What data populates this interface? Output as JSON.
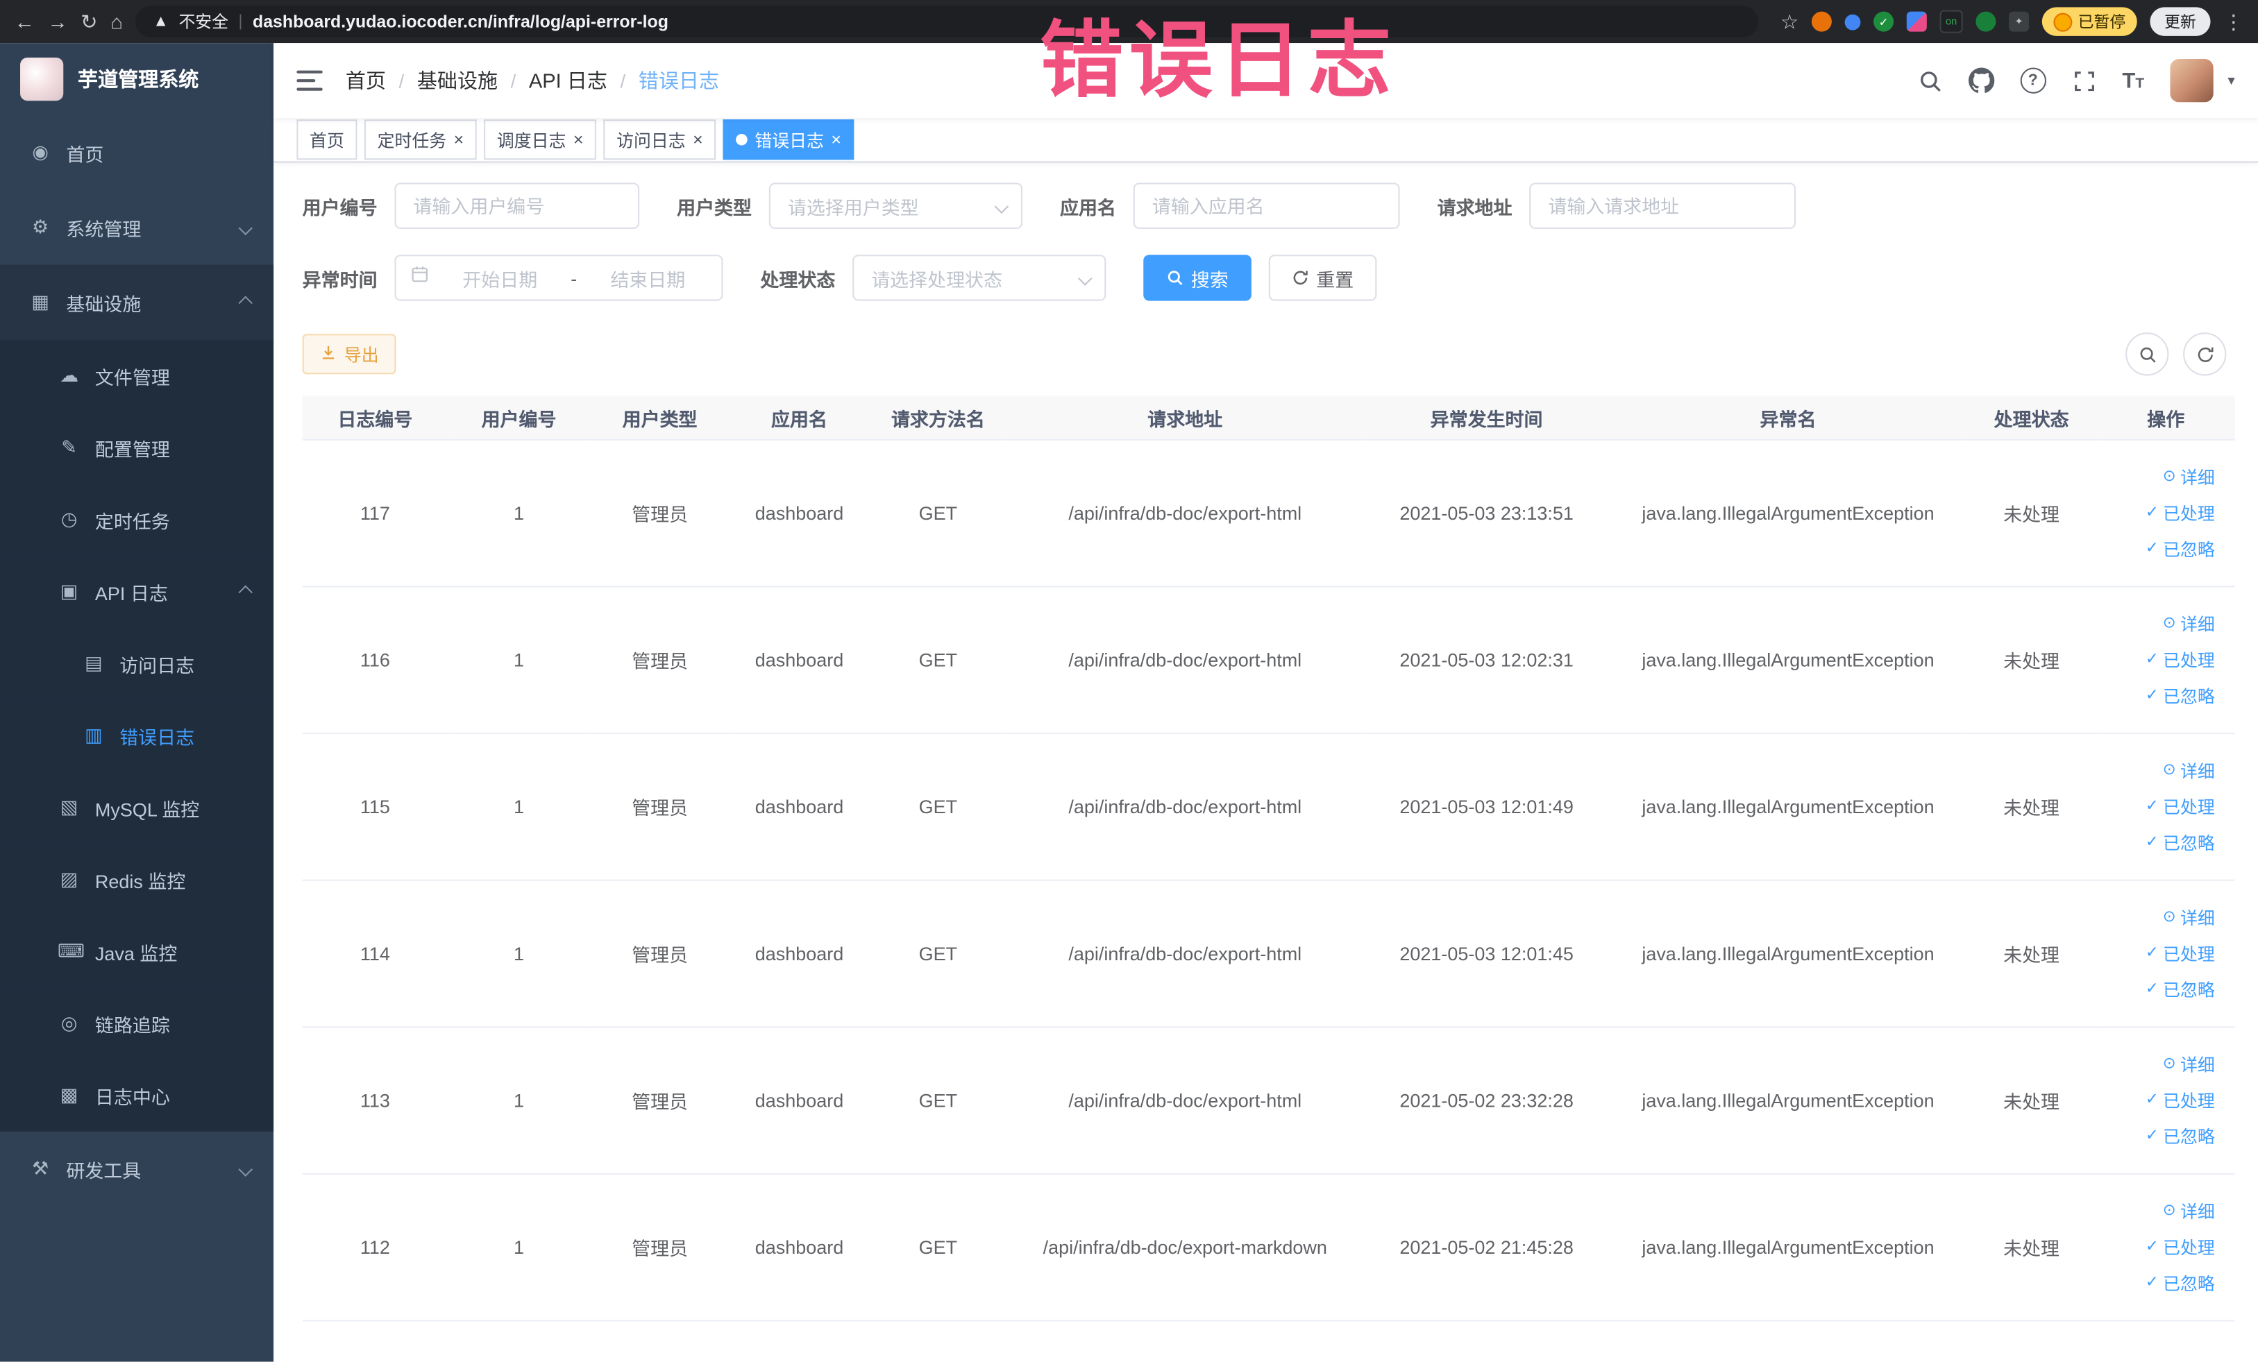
{
  "browser": {
    "security_label": "不安全",
    "url": "dashboard.yudao.iocoder.cn/infra/log/api-error-log",
    "paused_badge": "已暂停",
    "update_button": "更新",
    "extension_badge_on": "on"
  },
  "overlay": {
    "title": "错误日志",
    "color": "#f0517f"
  },
  "sidebar": {
    "app_title": "芋道管理系统",
    "items": {
      "home": "首页",
      "system": "系统管理",
      "infra": "基础设施",
      "file": "文件管理",
      "config": "配置管理",
      "job": "定时任务",
      "api_log": "API 日志",
      "access_log": "访问日志",
      "error_log": "错误日志",
      "mysql": "MySQL 监控",
      "redis": "Redis 监控",
      "java": "Java 监控",
      "trace": "链路追踪",
      "log_center": "日志中心",
      "dev_tools": "研发工具"
    }
  },
  "breadcrumb": {
    "separator": "/",
    "items": [
      "首页",
      "基础设施",
      "API 日志",
      "错误日志"
    ]
  },
  "tabs": [
    {
      "label": "首页"
    },
    {
      "label": "定时任务"
    },
    {
      "label": "调度日志"
    },
    {
      "label": "访问日志"
    },
    {
      "label": "错误日志"
    }
  ],
  "filters": {
    "user_id": {
      "label": "用户编号",
      "placeholder": "请输入用户编号"
    },
    "user_type": {
      "label": "用户类型",
      "placeholder": "请选择用户类型"
    },
    "app_name": {
      "label": "应用名",
      "placeholder": "请输入应用名"
    },
    "request_url": {
      "label": "请求地址",
      "placeholder": "请输入请求地址"
    },
    "exception_time": {
      "label": "异常时间",
      "start_placeholder": "开始日期",
      "separator": "-",
      "end_placeholder": "结束日期"
    },
    "process_status": {
      "label": "处理状态",
      "placeholder": "请选择处理状态"
    },
    "search_button": "搜索",
    "reset_button": "重置"
  },
  "toolbar": {
    "export_button": "导出"
  },
  "table": {
    "columns": [
      "日志编号",
      "用户编号",
      "用户类型",
      "应用名",
      "请求方法名",
      "请求地址",
      "异常发生时间",
      "异常名",
      "处理状态",
      "操作"
    ],
    "row_actions": [
      "详细",
      "已处理",
      "已忽略"
    ],
    "rows": [
      [
        "117",
        "1",
        "管理员",
        "dashboard",
        "GET",
        "/api/infra/db-doc/export-html",
        "2021-05-03 23:13:51",
        "java.lang.IllegalArgumentException",
        "未处理"
      ],
      [
        "116",
        "1",
        "管理员",
        "dashboard",
        "GET",
        "/api/infra/db-doc/export-html",
        "2021-05-03 12:02:31",
        "java.lang.IllegalArgumentException",
        "未处理"
      ],
      [
        "115",
        "1",
        "管理员",
        "dashboard",
        "GET",
        "/api/infra/db-doc/export-html",
        "2021-05-03 12:01:49",
        "java.lang.IllegalArgumentException",
        "未处理"
      ],
      [
        "114",
        "1",
        "管理员",
        "dashboard",
        "GET",
        "/api/infra/db-doc/export-html",
        "2021-05-03 12:01:45",
        "java.lang.IllegalArgumentException",
        "未处理"
      ],
      [
        "113",
        "1",
        "管理员",
        "dashboard",
        "GET",
        "/api/infra/db-doc/export-html",
        "2021-05-02 23:32:28",
        "java.lang.IllegalArgumentException",
        "未处理"
      ],
      [
        "112",
        "1",
        "管理员",
        "dashboard",
        "GET",
        "/api/infra/db-doc/export-markdown",
        "2021-05-02 21:45:28",
        "java.lang.IllegalArgumentException",
        "未处理"
      ]
    ]
  },
  "colors": {
    "accent": "#409eff",
    "warning": "#e6a23c",
    "sidebar_bg": "#304156",
    "submenu_bg": "#1f2d3d"
  }
}
